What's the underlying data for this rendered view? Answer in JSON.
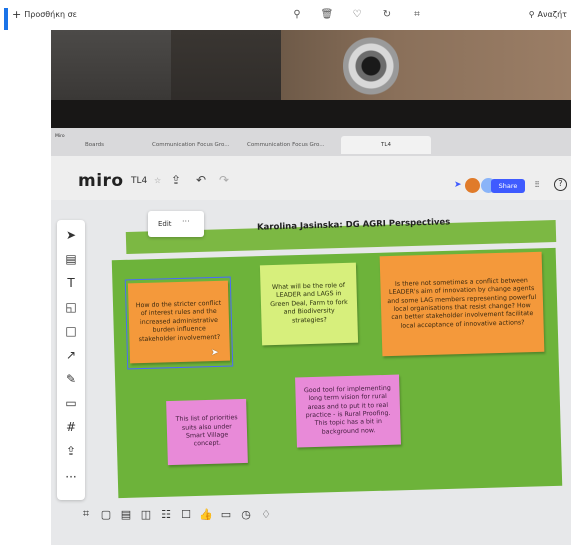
{
  "viewer": {
    "add_label": "Προσθήκη σε",
    "search_label": "Αναζήτ",
    "tools": [
      "zoom-icon",
      "delete-icon",
      "heart-icon",
      "rotate-icon",
      "crop-icon"
    ]
  },
  "browser": {
    "app_label": "Miro",
    "boards_label": "Boards",
    "tabs": [
      {
        "label": "Communication Focus Gro..."
      },
      {
        "label": "Communication Focus Gro..."
      },
      {
        "label": "TL4"
      }
    ]
  },
  "miro": {
    "logo": "miro",
    "board_name": "TL4",
    "share_label": "Share",
    "edit_label": "Edit",
    "edit_more": "···",
    "board_title": "Karolina Jasinska: DG AGRI Perspectives",
    "notes": [
      {
        "text": "How do the stricter conflict of interest rules and the increased administrative burden influence stakeholder involvement?",
        "color": "orange"
      },
      {
        "text": "What will be the role of LEADER and LAGS in Green Deal, Farm to fork and Biodiversity strategies?",
        "color": "yellow"
      },
      {
        "text": "Is there not sometimes a conflict between LEADER's aim of innovation by change agents and some LAG members representing powerful local organisations that resist change? How can better stakeholder involvement facilitate local acceptance of innovative actions?",
        "color": "orange"
      },
      {
        "text": "This list of priorities suits also under Smart Village concept.",
        "color": "pink"
      },
      {
        "text": "Good tool for implementing long term vision for rural areas and to put it to real practice - is Rural Proofing. This topic has a bit in background now.",
        "color": "pink"
      }
    ]
  },
  "colors": {
    "frame_green": "#6db33a",
    "banner_green": "#7cb843",
    "note_orange": "#f4993b",
    "note_yellow": "#d7ef7c",
    "note_pink": "#e88ad8",
    "share_blue": "#3f5bff"
  }
}
